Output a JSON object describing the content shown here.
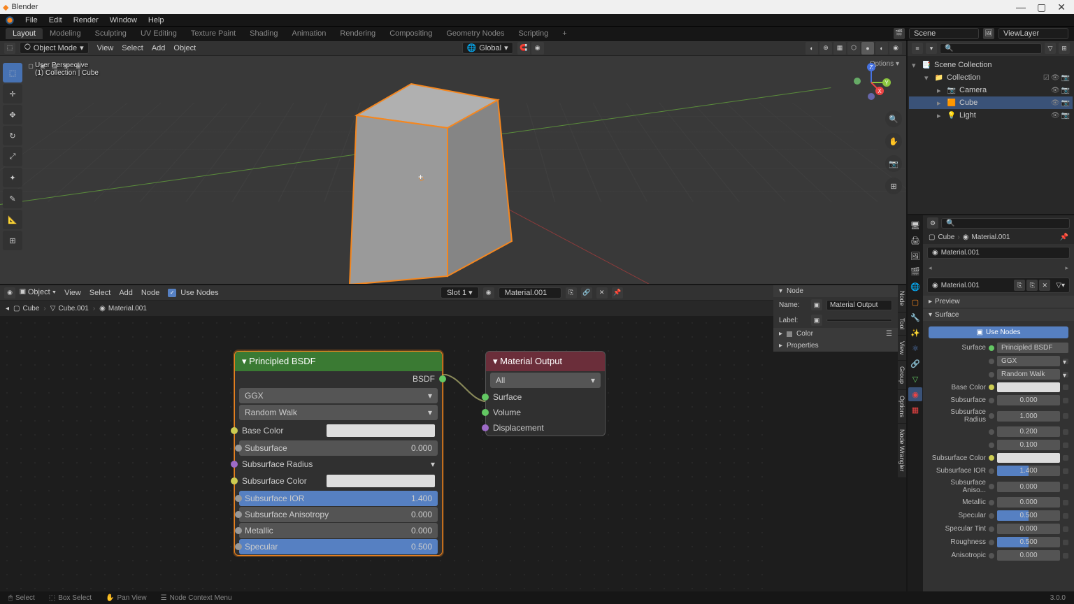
{
  "app": {
    "title": "Blender"
  },
  "menubar": [
    "File",
    "Edit",
    "Render",
    "Window",
    "Help"
  ],
  "workspaces": {
    "tabs": [
      "Layout",
      "Modeling",
      "Sculpting",
      "UV Editing",
      "Texture Paint",
      "Shading",
      "Animation",
      "Rendering",
      "Compositing",
      "Geometry Nodes",
      "Scripting"
    ],
    "active": "Layout",
    "scene": "Scene",
    "viewlayer": "ViewLayer"
  },
  "viewport3d": {
    "mode": "Object Mode",
    "menus": [
      "View",
      "Select",
      "Add",
      "Object"
    ],
    "orientation": "Global",
    "info_line1": "User Perspective",
    "info_line2": "(1) Collection | Cube",
    "options_label": "Options"
  },
  "outliner": {
    "tree": [
      {
        "label": "Scene Collection",
        "depth": 0,
        "icon": "📑"
      },
      {
        "label": "Collection",
        "depth": 1,
        "icon": "📁",
        "toggles": true
      },
      {
        "label": "Camera",
        "depth": 2,
        "icon": "📷",
        "obj": true
      },
      {
        "label": "Cube",
        "depth": 2,
        "icon": "🟧",
        "obj": true,
        "selected": true
      },
      {
        "label": "Light",
        "depth": 2,
        "icon": "💡",
        "obj": true
      }
    ]
  },
  "node_editor": {
    "type": "Object",
    "menus": [
      "View",
      "Select",
      "Add",
      "Node"
    ],
    "use_nodes": "Use Nodes",
    "slot": "Slot 1",
    "material": "Material.001",
    "breadcrumb": [
      "Cube",
      "Cube.001",
      "Material.001"
    ],
    "side_panel": {
      "node_header": "Node",
      "name_label": "Name:",
      "name_value": "Material Output",
      "label_label": "Label:",
      "color_label": "Color",
      "properties_label": "Properties"
    },
    "side_tabs": [
      "Node",
      "Tool",
      "View",
      "Group",
      "Options",
      "Node Wrangler"
    ],
    "bsdf_node": {
      "title": "Principled BSDF",
      "output": "BSDF",
      "distribution": "GGX",
      "subsurface_method": "Random Walk",
      "rows": [
        {
          "label": "Base Color",
          "type": "color"
        },
        {
          "label": "Subsurface",
          "value": "0.000"
        },
        {
          "label": "Subsurface Radius",
          "type": "dropdown"
        },
        {
          "label": "Subsurface Color",
          "type": "color"
        },
        {
          "label": "Subsurface IOR",
          "value": "1.400",
          "blue": true
        },
        {
          "label": "Subsurface Anisotropy",
          "value": "0.000"
        },
        {
          "label": "Metallic",
          "value": "0.000"
        },
        {
          "label": "Specular",
          "value": "0.500",
          "blue": true
        }
      ]
    },
    "output_node": {
      "title": "Material Output",
      "target": "All",
      "inputs": [
        "Surface",
        "Volume",
        "Displacement"
      ]
    }
  },
  "properties": {
    "object": "Cube",
    "material_crumb": "Material.001",
    "material_name": "Material.001",
    "material_field": "Material.001",
    "preview_label": "Preview",
    "surface_label": "Surface",
    "use_nodes": "Use Nodes",
    "surface_input": "Surface",
    "surface_value": "Principled BSDF",
    "params": [
      {
        "label": "",
        "value": "GGX",
        "type": "select"
      },
      {
        "label": "",
        "value": "Random Walk",
        "type": "select"
      },
      {
        "label": "Base Color",
        "type": "swatch"
      },
      {
        "label": "Subsurface",
        "value": "0.000"
      },
      {
        "label": "Subsurface Radius",
        "value": "1.000"
      },
      {
        "label": "",
        "value": "0.200"
      },
      {
        "label": "",
        "value": "0.100"
      },
      {
        "label": "Subsurface Color",
        "type": "swatch"
      },
      {
        "label": "Subsurface IOR",
        "value": "1.400",
        "blue": true
      },
      {
        "label": "Subsurface Aniso...",
        "value": "0.000"
      },
      {
        "label": "Metallic",
        "value": "0.000"
      },
      {
        "label": "Specular",
        "value": "0.500",
        "blue": true
      },
      {
        "label": "Specular Tint",
        "value": "0.000"
      },
      {
        "label": "Roughness",
        "value": "0.500",
        "blue": true
      },
      {
        "label": "Anisotropic",
        "value": "0.000"
      }
    ]
  },
  "statusbar": {
    "items": [
      "Select",
      "Box Select",
      "Pan View",
      "Node Context Menu"
    ],
    "version": "3.0.0"
  }
}
